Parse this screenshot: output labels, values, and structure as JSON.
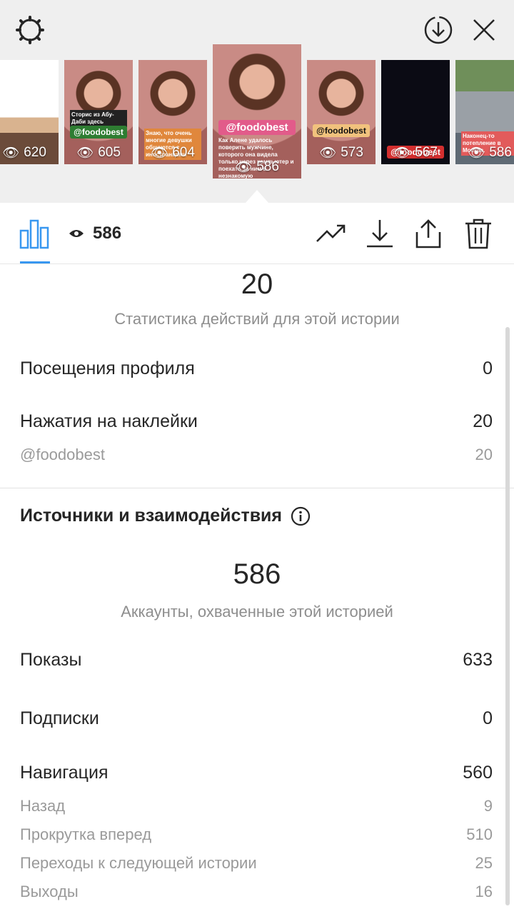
{
  "top": {
    "icons": {
      "settings": "gear-icon",
      "download": "download-circle-icon",
      "close": "close-icon"
    },
    "thumbnails": [
      {
        "views": "620"
      },
      {
        "views": "605",
        "tag": "@foodobest",
        "caption": "Сторис из Абу-Даби здесь"
      },
      {
        "views": "604",
        "caption": "Знаю, что очень многие девушки общаются с иностранцами"
      },
      {
        "views": "586",
        "tag": "@foodobest",
        "caption": "Как Алене удалось поверить мужчине, которого она видела только через компьютер и поехать за ним в незнакомую"
      },
      {
        "views": "573",
        "tag": "@foodobest"
      },
      {
        "views": "567",
        "tag": "@foodobest"
      },
      {
        "views": "586",
        "caption": "Наконец-то потепление в Москве."
      }
    ]
  },
  "toolbar": {
    "views": "586",
    "icons": {
      "stats": "bar-chart-icon",
      "eye": "eye-icon",
      "promote": "trend-icon",
      "save": "download-icon",
      "share": "share-icon",
      "delete": "trash-icon"
    }
  },
  "interactions": {
    "total": "20",
    "caption": "Статистика действий для этой истории",
    "rows": [
      {
        "label": "Посещения профиля",
        "value": "0"
      },
      {
        "label": "Нажатия на наклейки",
        "value": "20"
      }
    ],
    "sub_rows": [
      {
        "label": "@foodobest",
        "value": "20"
      }
    ]
  },
  "discovery": {
    "title": "Источники и взаимодействия",
    "reach": "586",
    "reach_caption": "Аккаунты, охваченные этой историей",
    "rows": [
      {
        "label": "Показы",
        "value": "633"
      },
      {
        "label": "Подписки",
        "value": "0"
      },
      {
        "label": "Навигация",
        "value": "560"
      }
    ],
    "navigation": [
      {
        "label": "Назад",
        "value": "9"
      },
      {
        "label": "Прокрутка вперед",
        "value": "510"
      },
      {
        "label": "Переходы к следующей истории",
        "value": "25"
      },
      {
        "label": "Выходы",
        "value": "16"
      }
    ]
  },
  "colors": {
    "accent": "#3897f0",
    "text": "#262626",
    "muted": "#8e8e8e"
  }
}
